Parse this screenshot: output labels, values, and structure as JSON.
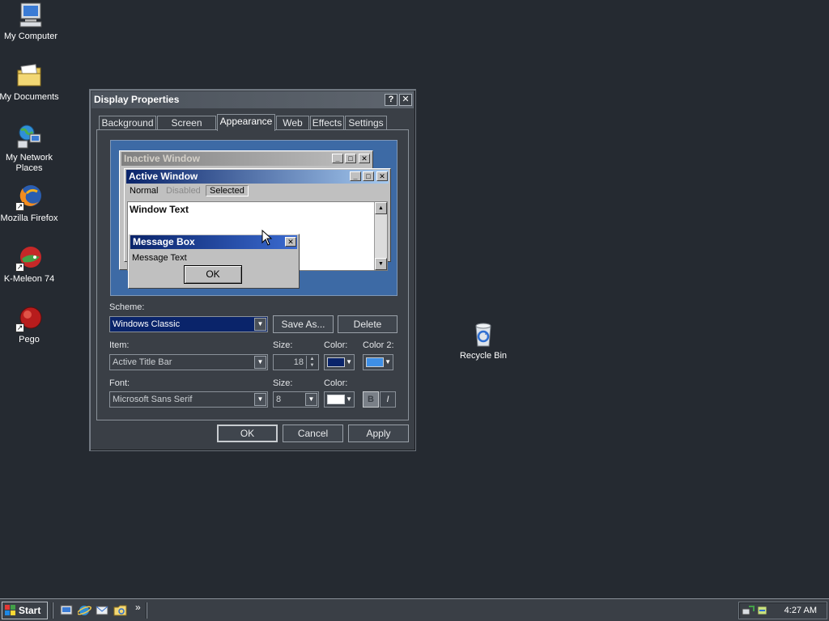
{
  "desktop": {
    "icons": [
      {
        "label": "My Computer",
        "icon": "computer-icon"
      },
      {
        "label": "My Documents",
        "icon": "folder-icon"
      },
      {
        "label": "My Network Places",
        "icon": "network-icon"
      },
      {
        "label": "Mozilla Firefox",
        "icon": "firefox-icon"
      },
      {
        "label": "K-Meleon 74",
        "icon": "kmeleon-icon"
      },
      {
        "label": "Pego",
        "icon": "pego-icon"
      },
      {
        "label": "Recycle Bin",
        "icon": "recycle-bin-icon"
      }
    ]
  },
  "window": {
    "title": "Display Properties",
    "help_glyph": "?",
    "close_glyph": "✕",
    "tabs": [
      "Background",
      "Screen Saver",
      "Appearance",
      "Web",
      "Effects",
      "Settings"
    ],
    "active_tab": "Appearance"
  },
  "preview": {
    "inactive_title": "Inactive Window",
    "active_title": "Active Window",
    "menu_normal": "Normal",
    "menu_disabled": "Disabled",
    "menu_selected": "Selected",
    "window_text": "Window Text",
    "msgbox_title": "Message Box",
    "msgbox_text": "Message Text",
    "msgbox_ok": "OK"
  },
  "form": {
    "scheme_label": "Scheme:",
    "scheme_value": "Windows Classic",
    "save_as": "Save As...",
    "delete": "Delete",
    "item_label": "Item:",
    "item_value": "Active Title Bar",
    "size_label": "Size:",
    "item_size": "18",
    "color_label": "Color:",
    "color2_label": "Color 2:",
    "font_label": "Font:",
    "font_value": "Microsoft Sans Serif",
    "font_size": "8",
    "bold_glyph": "B",
    "italic_glyph": "I"
  },
  "footer": {
    "ok": "OK",
    "cancel": "Cancel",
    "apply": "Apply"
  },
  "taskbar": {
    "start": "Start",
    "chevron": "»",
    "clock": "4:27 AM"
  },
  "colors": {
    "desktop": "#252a31",
    "window": "#3a3f46",
    "preview_bg": "#3d6aa5",
    "active_title_start": "#0a246a",
    "active_title_end": "#a6caf0",
    "inactive_title_start": "#808080",
    "inactive_title_end": "#c0c0c0",
    "item_color1": "#0a246a",
    "item_color2": "#3e8fe6",
    "font_color": "#ffffff"
  }
}
